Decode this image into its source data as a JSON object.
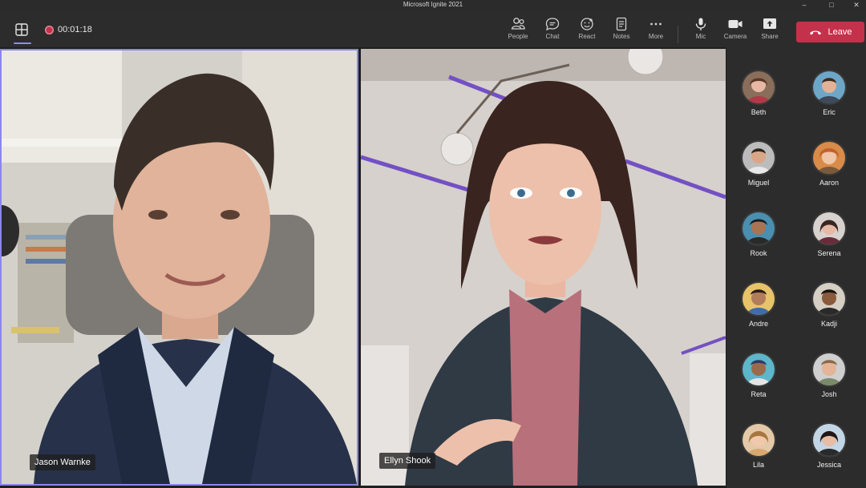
{
  "window": {
    "title": "Microsoft Ignite 2021"
  },
  "toolbar": {
    "timer": "00:01:18",
    "tools": [
      {
        "id": "people",
        "label": "People",
        "icon": "people-icon"
      },
      {
        "id": "chat",
        "label": "Chat",
        "icon": "chat-icon"
      },
      {
        "id": "react",
        "label": "React",
        "icon": "react-icon"
      },
      {
        "id": "notes",
        "label": "Notes",
        "icon": "notes-icon"
      },
      {
        "id": "more",
        "label": "More",
        "icon": "more-icon"
      },
      {
        "id": "mic",
        "label": "Mic",
        "icon": "mic-icon"
      },
      {
        "id": "camera",
        "label": "Camera",
        "icon": "camera-icon"
      },
      {
        "id": "share",
        "label": "Share",
        "icon": "share-icon"
      }
    ],
    "leave_label": "Leave"
  },
  "stage": {
    "left": {
      "name": "Jason Warnke"
    },
    "right": {
      "name": "Ellyn Shook"
    }
  },
  "participants": [
    {
      "name": "Beth"
    },
    {
      "name": "Eric"
    },
    {
      "name": "Miguel"
    },
    {
      "name": "Aaron"
    },
    {
      "name": "Rook"
    },
    {
      "name": "Serena"
    },
    {
      "name": "Andre"
    },
    {
      "name": "Kadji"
    },
    {
      "name": "Reta"
    },
    {
      "name": "Josh"
    },
    {
      "name": "Lila"
    },
    {
      "name": "Jessica"
    }
  ],
  "colors": {
    "accent": "#8b87e8",
    "leave": "#c4314b",
    "record": "#c4314b"
  }
}
